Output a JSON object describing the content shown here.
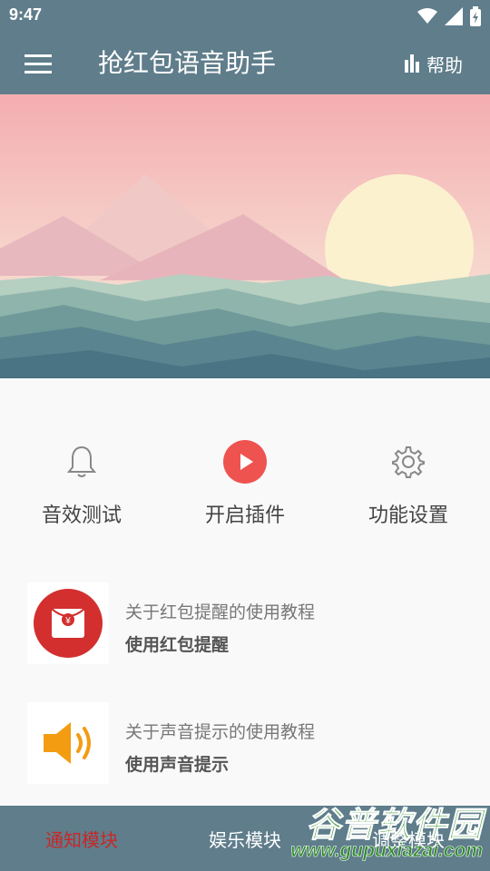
{
  "status_bar": {
    "time": "9:47",
    "icons": [
      "wifi-icon",
      "signal-icon",
      "battery-icon"
    ]
  },
  "app_bar": {
    "title": "抢红包语音助手",
    "help_label": "帮助",
    "menu_icon": "menu-icon",
    "help_icon": "bar-chart-icon"
  },
  "actions": [
    {
      "label": "音效测试",
      "icon": "bell-icon"
    },
    {
      "label": "开启插件",
      "icon": "play-icon"
    },
    {
      "label": "功能设置",
      "icon": "gear-icon"
    }
  ],
  "cards": [
    {
      "subtitle": "关于红包提醒的使用教程",
      "title": "使用红包提醒",
      "icon": "red-envelope-icon",
      "icon_glyph": "¥"
    },
    {
      "subtitle": "关于声音提示的使用教程",
      "title": "使用声音提示",
      "icon": "speaker-icon"
    }
  ],
  "bottom_nav": [
    {
      "label": "通知模块",
      "active": true
    },
    {
      "label": "娱乐模块",
      "active": false
    },
    {
      "label": "调整模块",
      "active": false
    }
  ],
  "watermark": {
    "title": "谷普软件园",
    "url": "www.gupuxiazai.com"
  },
  "colors": {
    "primary": "#5f7d8b",
    "accent_red": "#ef5350",
    "active_tab": "#c62828",
    "envelope_red": "#d32f2f",
    "speaker_orange": "#f39c12"
  }
}
